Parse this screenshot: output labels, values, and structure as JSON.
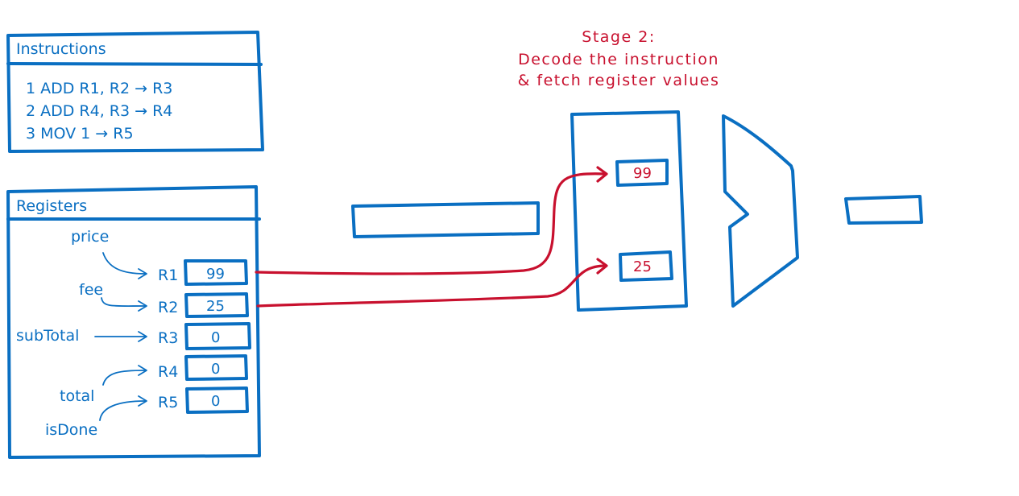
{
  "colors": {
    "primary": "#0a6fc2",
    "highlight": "#c8102e",
    "background": "#ffffff"
  },
  "instructions": {
    "title": "Instructions",
    "lines": [
      "1  ADD  R1,  R2 → R3",
      "2  ADD  R4,  R3 → R4",
      "3  MOV  1 → R5"
    ]
  },
  "registers": {
    "title": "Registers",
    "items": [
      {
        "name": "R1",
        "value": "99",
        "variable": "price"
      },
      {
        "name": "R2",
        "value": "25",
        "variable": "fee"
      },
      {
        "name": "R3",
        "value": "0",
        "variable": "subTotal"
      },
      {
        "name": "R4",
        "value": "0",
        "variable": "total"
      },
      {
        "name": "R5",
        "value": "0",
        "variable": "isDone"
      }
    ]
  },
  "stage": {
    "title_lines": [
      "Stage 2:",
      "Decode the instruction",
      "& fetch register values"
    ],
    "decode_values": [
      "99",
      "25"
    ]
  }
}
